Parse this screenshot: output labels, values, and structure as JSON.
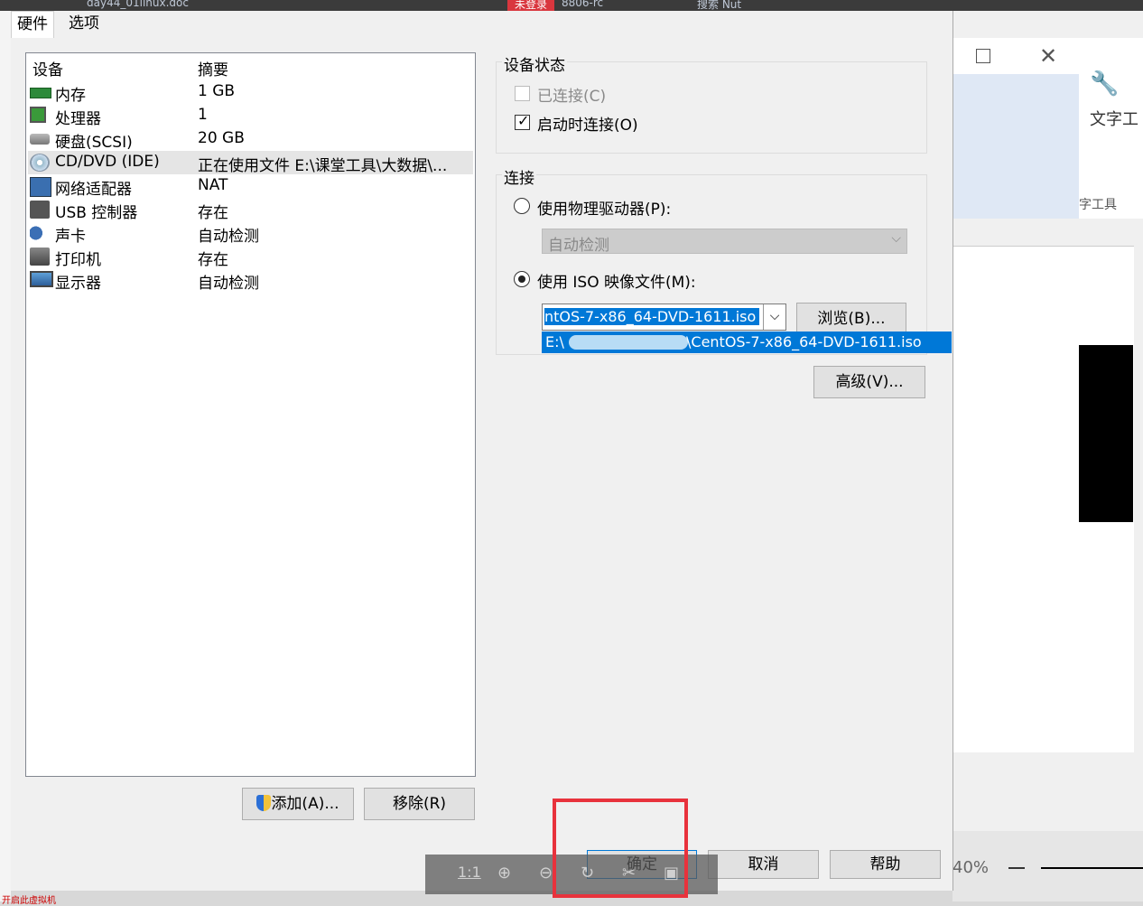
{
  "taskbar": {
    "doc_title": "day44_01linux.doc",
    "not_logged_in": "未登录",
    "code": "8806-rc",
    "search": "搜索 Nut",
    "left_item": "开启此虚拟机"
  },
  "background_window": {
    "tool_label": "文字工",
    "tool_label2": "字工具",
    "zoom": "40%"
  },
  "tabs": [
    "硬件",
    "选项"
  ],
  "device_list": {
    "col_device": "设备",
    "col_summary": "摘要",
    "rows": [
      {
        "name": "内存",
        "summary": "1 GB",
        "icon": "memory-icon"
      },
      {
        "name": "处理器",
        "summary": "1",
        "icon": "processor-icon"
      },
      {
        "name": "硬盘(SCSI)",
        "summary": "20 GB",
        "icon": "harddisk-icon"
      },
      {
        "name": "CD/DVD (IDE)",
        "summary": "正在使用文件 E:\\课堂工具\\大数据\\...",
        "icon": "cdrom-icon"
      },
      {
        "name": "网络适配器",
        "summary": "NAT",
        "icon": "network-icon"
      },
      {
        "name": "USB 控制器",
        "summary": "存在",
        "icon": "usb-icon"
      },
      {
        "name": "声卡",
        "summary": "自动检测",
        "icon": "sound-icon"
      },
      {
        "name": "打印机",
        "summary": "存在",
        "icon": "printer-icon"
      },
      {
        "name": "显示器",
        "summary": "自动检测",
        "icon": "display-icon"
      }
    ],
    "selected_index": 3
  },
  "buttons": {
    "add": "添加(A)...",
    "remove": "移除(R)",
    "browse": "浏览(B)...",
    "advanced": "高级(V)...",
    "ok": "确定",
    "cancel": "取消",
    "help": "帮助"
  },
  "device_status": {
    "title": "设备状态",
    "connected": "已连接(C)",
    "connected_checked": false,
    "connect_on_start": "启动时连接(O)",
    "connect_on_start_checked": true
  },
  "connection": {
    "title": "连接",
    "physical": "使用物理驱动器(P):",
    "physical_selected": false,
    "physical_value": "自动检测",
    "iso": "使用 ISO 映像文件(M):",
    "iso_selected": true,
    "iso_value": "ntOS-7-x86_64-DVD-1611.iso",
    "dropdown_prefix": "E:\\",
    "dropdown_suffix": "\\CentOS-7-x86_64-DVD-1611.iso"
  },
  "viewer_toolbar": {
    "ratio": "1:1"
  }
}
